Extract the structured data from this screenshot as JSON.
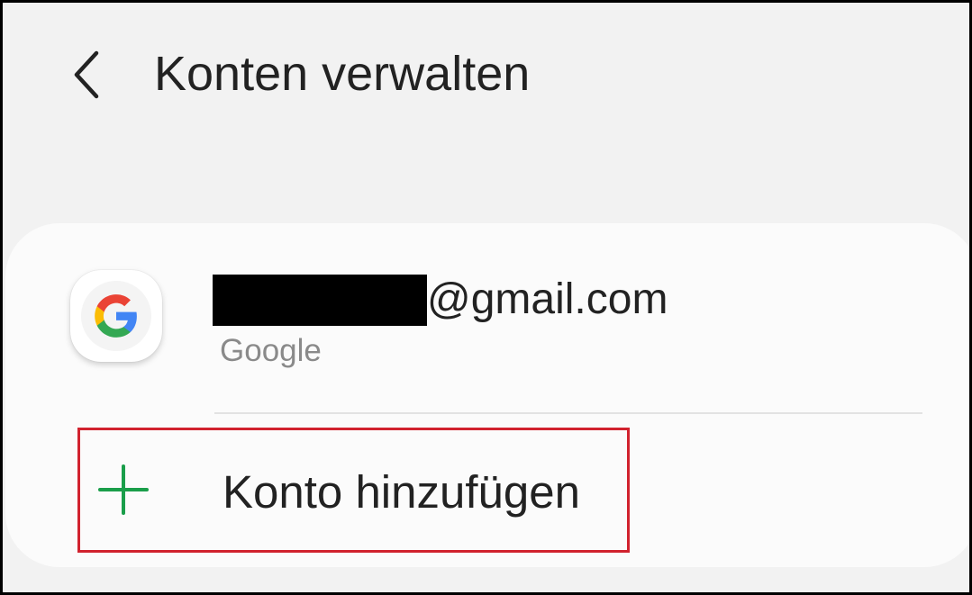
{
  "header": {
    "back_icon": "chevron-left-icon",
    "title": "Konten verwalten"
  },
  "accounts": [
    {
      "icon": "google-g-icon",
      "email_redacted": true,
      "email_domain": "@gmail.com",
      "provider": "Google"
    }
  ],
  "add_account": {
    "icon": "plus-icon",
    "label": "Konto hinzufügen",
    "highlight_color": "#d1222e"
  },
  "colors": {
    "background": "#f2f2f2",
    "card": "#fbfbfb",
    "text": "#222222",
    "secondary_text": "#8a8a8a",
    "plus_green": "#1a9e4a",
    "google_blue": "#4285f4",
    "google_red": "#ea4335",
    "google_yellow": "#fbbc05",
    "google_green": "#34a853"
  }
}
